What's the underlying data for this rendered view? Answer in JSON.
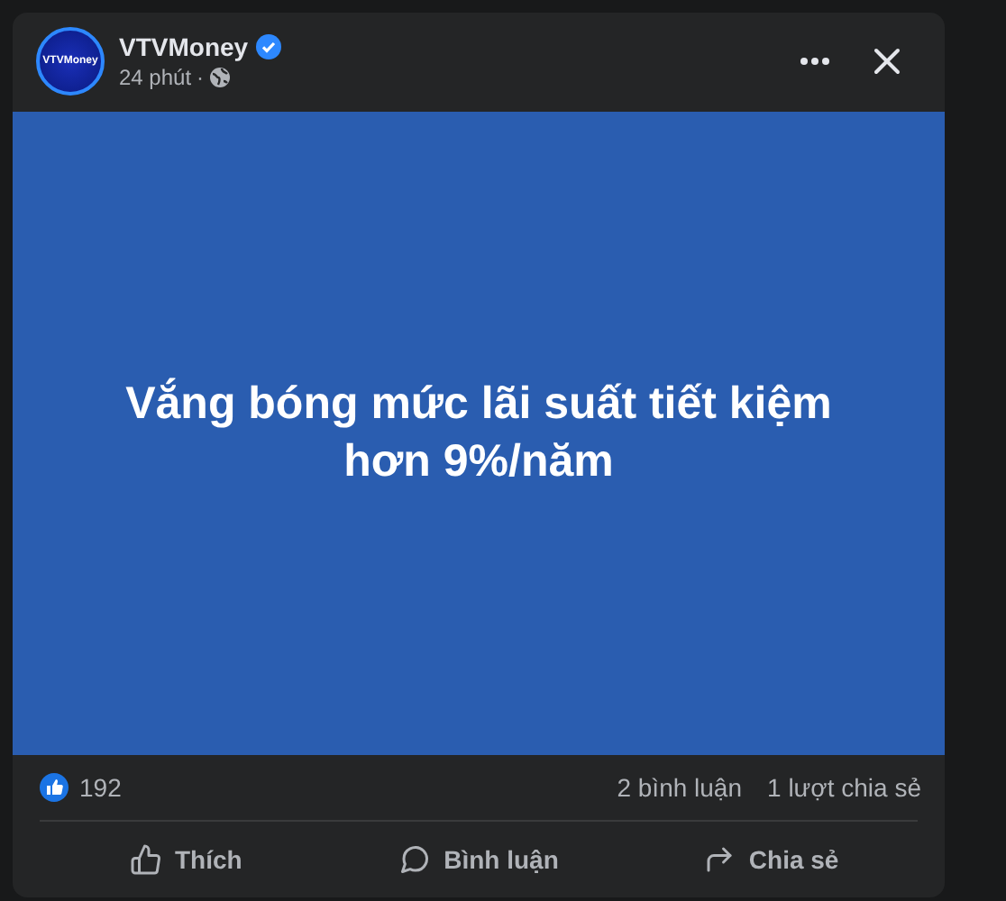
{
  "post": {
    "author": "VTVMoney",
    "avatar_text": "VTVMoney",
    "verified": true,
    "time": "24 phút",
    "separator": "·",
    "image_text": "Vắng bóng mức lãi suất tiết kiệm hơn 9%/năm",
    "reactions": "192",
    "comments": "2 bình luận",
    "shares": "1 lượt chia sẻ"
  },
  "actions": [
    {
      "kind": "like",
      "label": "Thích"
    },
    {
      "kind": "comment",
      "label": "Bình luận"
    },
    {
      "kind": "share",
      "label": "Chia sẻ"
    }
  ]
}
